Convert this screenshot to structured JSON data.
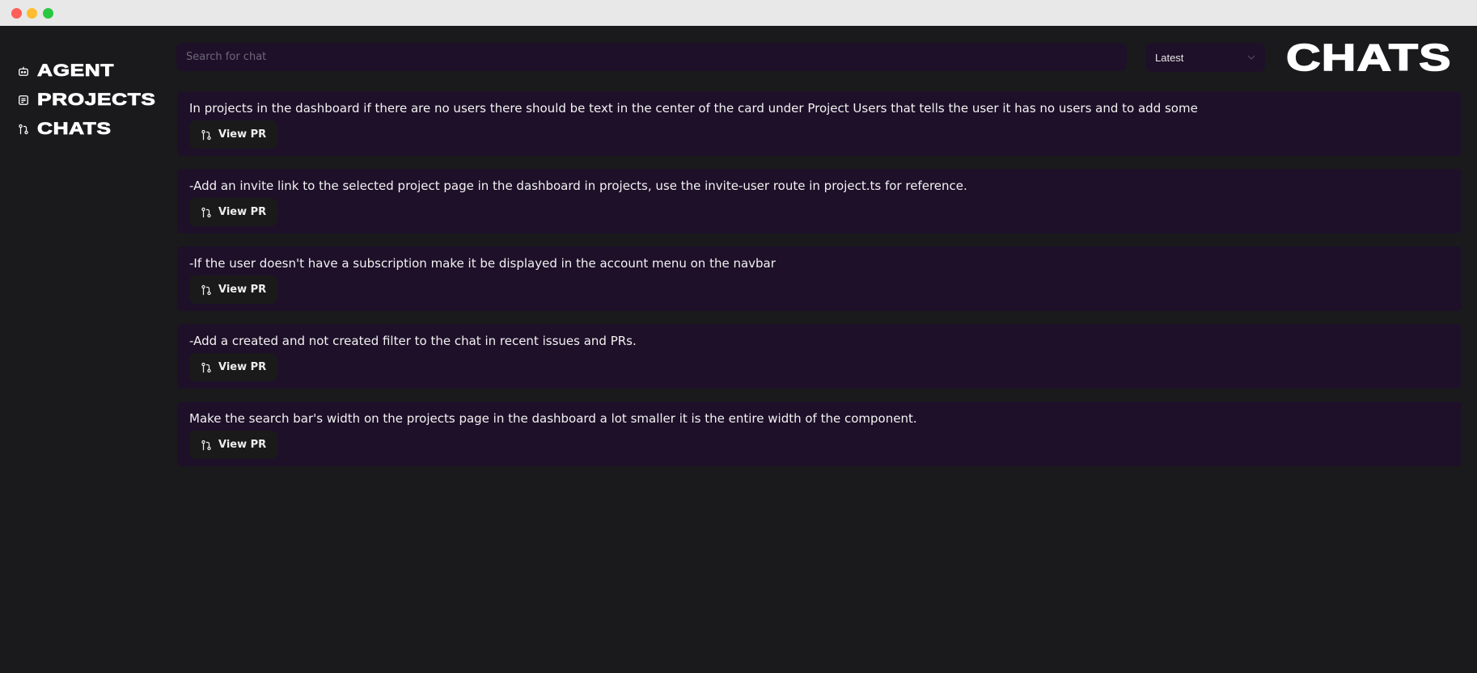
{
  "window": {
    "controls": [
      "close",
      "minimize",
      "maximize"
    ]
  },
  "sidebar": {
    "items": [
      {
        "label": "AGENT",
        "icon": "robot-icon"
      },
      {
        "label": "PROJECTS",
        "icon": "document-icon"
      },
      {
        "label": "CHATS",
        "icon": "git-pull-request-icon"
      }
    ]
  },
  "search": {
    "placeholder": "Search for chat",
    "value": ""
  },
  "sort": {
    "selected": "Latest"
  },
  "header": {
    "title": "CHATS"
  },
  "chats": [
    {
      "text": "In projects in the dashboard if there are no users there should be text in the center of the card under Project Users that tells the user it has no users and to add some",
      "button": "View PR"
    },
    {
      "text": "-Add an invite link to the selected project page in the dashboard in projects, use the invite-user route in project.ts for reference.",
      "button": "View PR"
    },
    {
      "text": "-If the user doesn't have a subscription make it be displayed in the account menu on the navbar",
      "button": "View PR"
    },
    {
      "text": "-Add a created and not created filter to the chat in recent issues and PRs.",
      "button": "View PR"
    },
    {
      "text": "Make the search bar's width on the projects page in the dashboard a lot smaller it is the entire width of the component.",
      "button": "View PR"
    }
  ],
  "colors": {
    "background": "#1a1a1c",
    "card": "#1e1029",
    "button": "#1a1a1a"
  }
}
